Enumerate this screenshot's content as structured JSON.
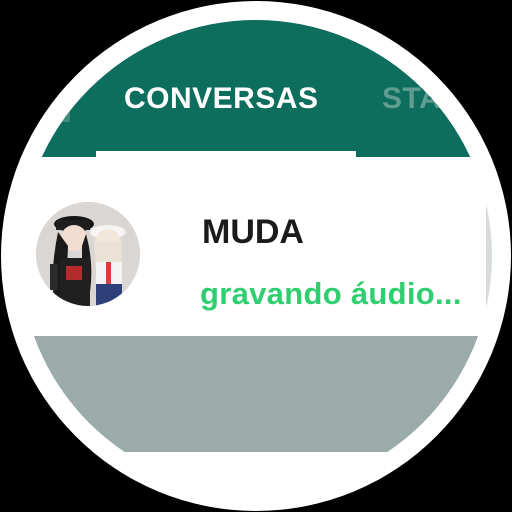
{
  "tabs": {
    "active_label": "CONVERSAS",
    "next_label": "STA"
  },
  "chat": {
    "name": "MUDA",
    "status": "gravando áudio..."
  },
  "colors": {
    "header": "#0d6e5d",
    "status_text": "#2fcf6f",
    "list_background": "#9aabaa"
  },
  "icons": {
    "avatar": "avatar-image"
  }
}
